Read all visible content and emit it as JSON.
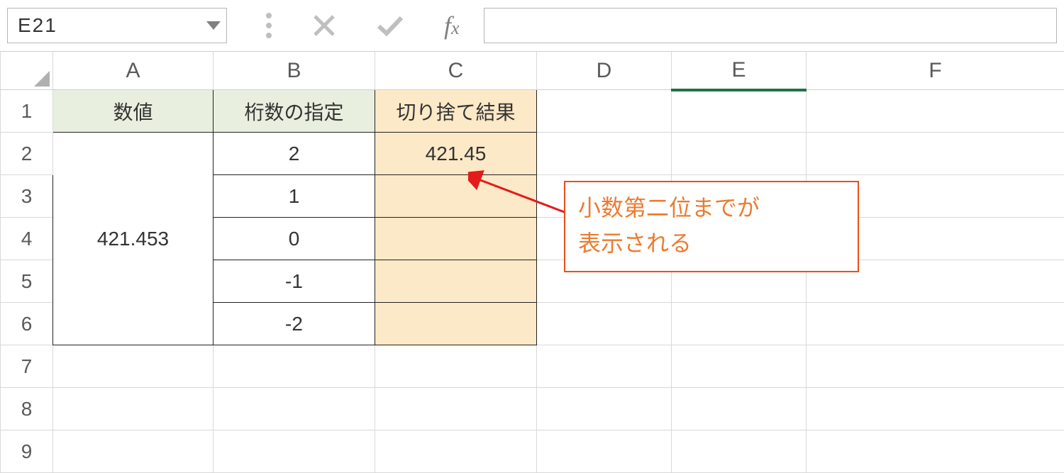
{
  "formulaBar": {
    "cellRef": "E21",
    "formula": ""
  },
  "columns": [
    "A",
    "B",
    "C",
    "D",
    "E",
    "F"
  ],
  "rowNumbers": [
    "1",
    "2",
    "3",
    "4",
    "5",
    "6",
    "7",
    "8",
    "9"
  ],
  "selectedColumn": "E",
  "headers": {
    "A": "数値",
    "B": "桁数の指定",
    "C": "切り捨て結果"
  },
  "table": {
    "number": "421.453",
    "rows": [
      {
        "digits": "2",
        "result": "421.45"
      },
      {
        "digits": "1",
        "result": ""
      },
      {
        "digits": "0",
        "result": ""
      },
      {
        "digits": "-1",
        "result": ""
      },
      {
        "digits": "-2",
        "result": ""
      }
    ]
  },
  "callout": {
    "line1": "小数第二位までが",
    "line2": "表示される"
  }
}
